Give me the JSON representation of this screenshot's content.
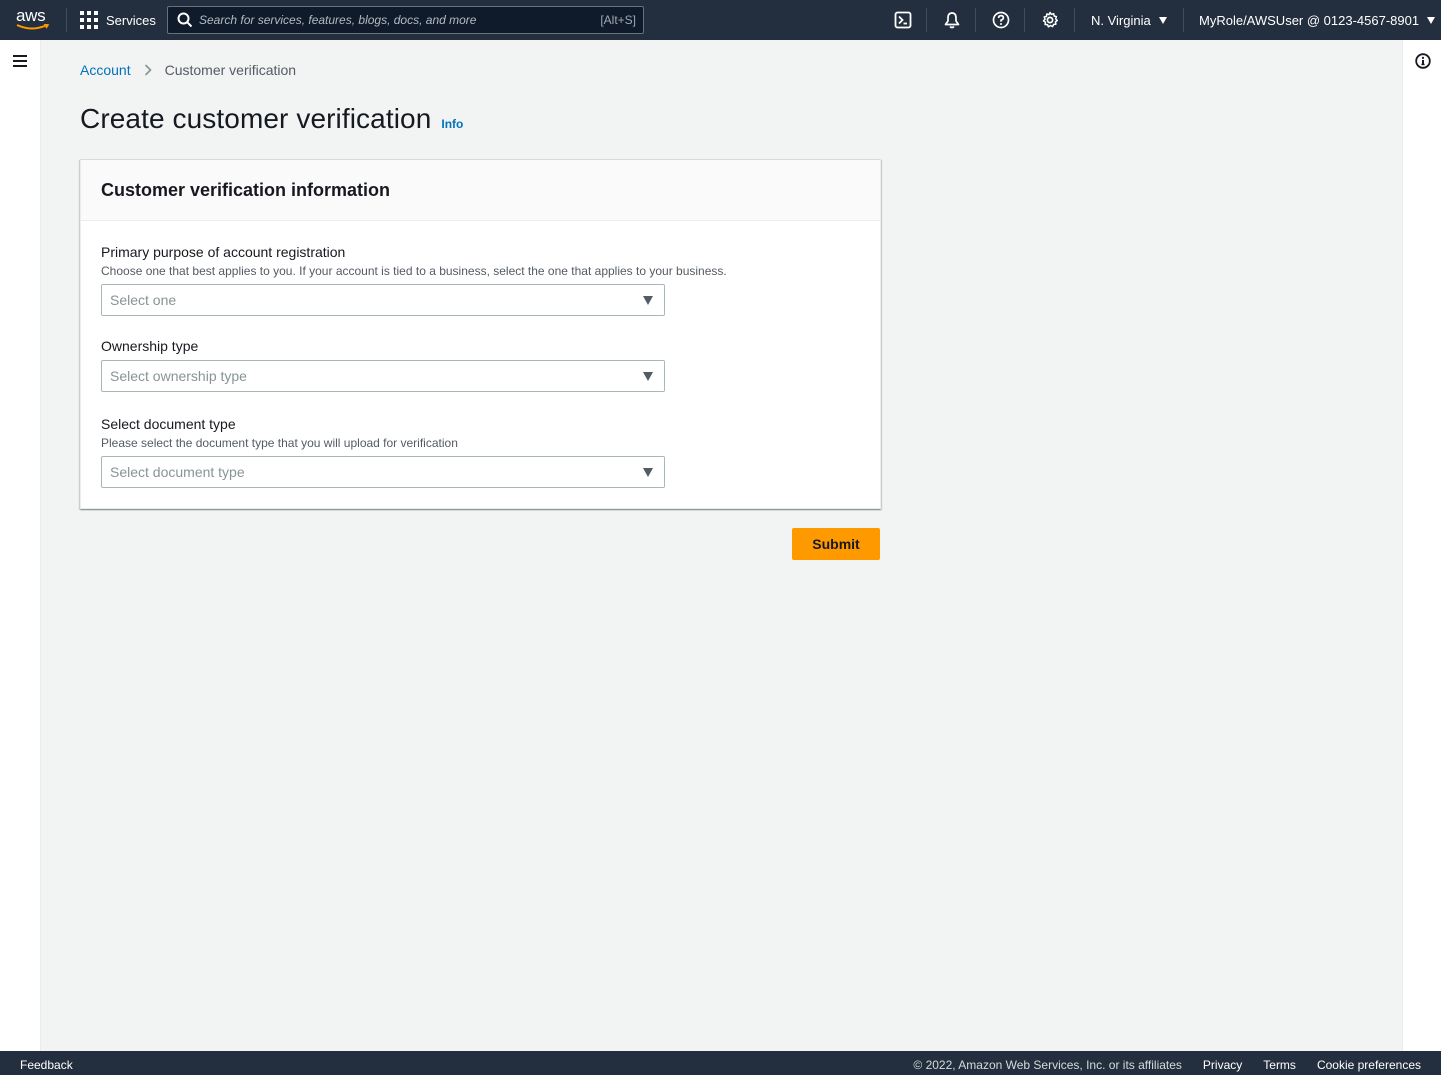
{
  "topnav": {
    "logo_text": "aws",
    "services_label": "Services",
    "search_placeholder": "Search for services, features, blogs, docs, and more",
    "search_shortcut": "[Alt+S]",
    "region_label": "N. Virginia",
    "account_label": "MyRole/AWSUser @ 0123-4567-8901",
    "icons": [
      "cloudshell-icon",
      "notifications-bell-icon",
      "help-icon",
      "settings-gear-icon"
    ]
  },
  "breadcrumb": {
    "items": [
      "Account",
      "Customer verification"
    ]
  },
  "page": {
    "title": "Create customer verification",
    "info_link": "Info"
  },
  "panel": {
    "title": "Customer verification information",
    "fields": [
      {
        "label": "Primary purpose of account registration",
        "description": "Choose one that best applies to you. If your account is tied to a business, select the one that applies to your business.",
        "placeholder": "Select one"
      },
      {
        "label": "Ownership type",
        "description": "",
        "placeholder": "Select ownership type"
      },
      {
        "label": "Select document type",
        "description": "Please select the document type that you will upload for verification",
        "placeholder": "Select document type"
      }
    ]
  },
  "actions": {
    "submit_label": "Submit"
  },
  "footer": {
    "feedback": "Feedback",
    "copyright": "© 2022, Amazon Web Services, Inc. or its affiliates",
    "links": [
      "Privacy",
      "Terms",
      "Cookie preferences"
    ]
  },
  "colors": {
    "nav_bg": "#232f3e",
    "link": "#0073bb",
    "primary_button": "#ff9900",
    "page_bg": "#f2f3f3"
  }
}
